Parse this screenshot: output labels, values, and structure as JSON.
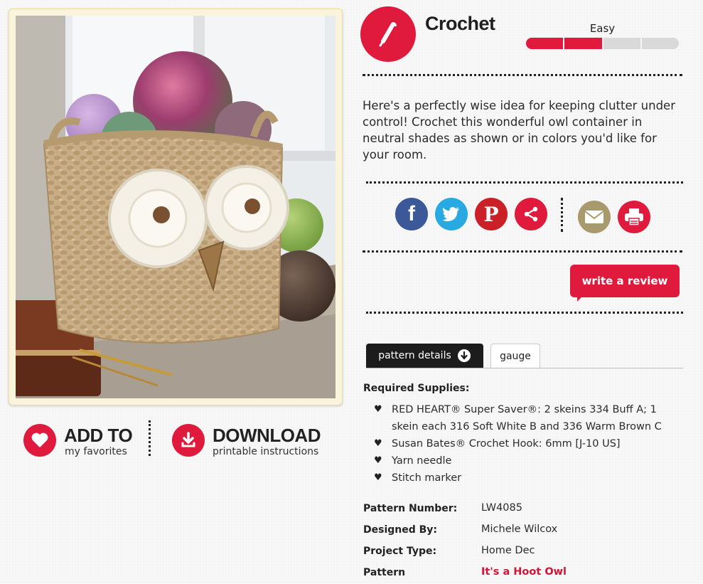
{
  "favorites": {
    "title": "ADD TO",
    "subtitle": "my favorites",
    "icon": "heart-icon"
  },
  "download": {
    "title": "DOWNLOAD",
    "subtitle": "printable instructions",
    "icon": "download-icon"
  },
  "craft": {
    "name": "Crochet",
    "icon": "crochet-hook-icon"
  },
  "difficulty": {
    "label": "Easy",
    "level": 2,
    "max": 4
  },
  "description": "Here's a perfectly wise idea for keeping clutter under control! Crochet this wonderful owl container in neutral shades as shown or in colors you'd like for your room.",
  "share": [
    {
      "name": "facebook",
      "glyph": "f",
      "color": "#3b5998"
    },
    {
      "name": "twitter",
      "glyph": "",
      "color": "#29a9e1"
    },
    {
      "name": "pinterest",
      "glyph": "P",
      "color": "#cb2027"
    },
    {
      "name": "share",
      "glyph": "",
      "color": "#e01a3c"
    }
  ],
  "utility": [
    {
      "name": "email",
      "color": "#a89a6c"
    },
    {
      "name": "print",
      "color": "#e01a3c"
    }
  ],
  "review_button": "write a review",
  "tabs": [
    {
      "label": "pattern details",
      "active": true
    },
    {
      "label": "gauge",
      "active": false
    }
  ],
  "supplies": {
    "heading": "Required Supplies:",
    "items": [
      "RED HEART® Super Saver®: 2 skeins 334 Buff A; 1 skein each 316 Soft White B and 336 Warm Brown C",
      "Susan Bates® Crochet Hook: 6mm [J-10 US]",
      "Yarn needle",
      "Stitch marker"
    ]
  },
  "details": [
    {
      "label": "Pattern Number:",
      "value": "LW4085"
    },
    {
      "label": "Designed By:",
      "value": "Michele Wilcox"
    },
    {
      "label": "Project Type:",
      "value": "Home Dec"
    },
    {
      "label": "Pattern",
      "value": "It's a Hoot Owl",
      "link": true
    }
  ],
  "colors": {
    "accent": "#e01a3c",
    "link": "#d21437",
    "text": "#2b2b2b"
  }
}
